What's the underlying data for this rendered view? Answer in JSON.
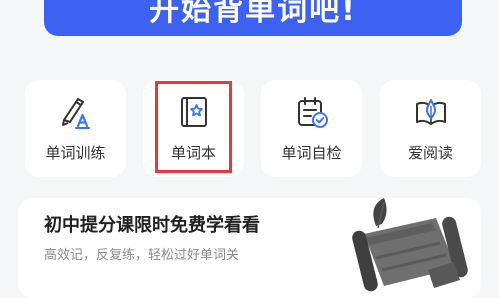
{
  "cta": {
    "label": "开始背单词吧!"
  },
  "tools": [
    {
      "label": "单词训练",
      "icon": "pen-letter-a-icon"
    },
    {
      "label": "单词本",
      "icon": "star-notebook-icon"
    },
    {
      "label": "单词自检",
      "icon": "calendar-check-icon"
    },
    {
      "label": "爱阅读",
      "icon": "open-book-leaf-icon"
    }
  ],
  "promo": {
    "title": "初中提分课限时免费学看看",
    "subtitle": "高效记，反复练，轻松过好单词关",
    "icon": "scroll-feather-illustration"
  },
  "colors": {
    "accent": "#3d62f1",
    "highlight": "#e23a3a",
    "icon_accent": "#3b72f6",
    "icon_stroke": "#333333"
  }
}
